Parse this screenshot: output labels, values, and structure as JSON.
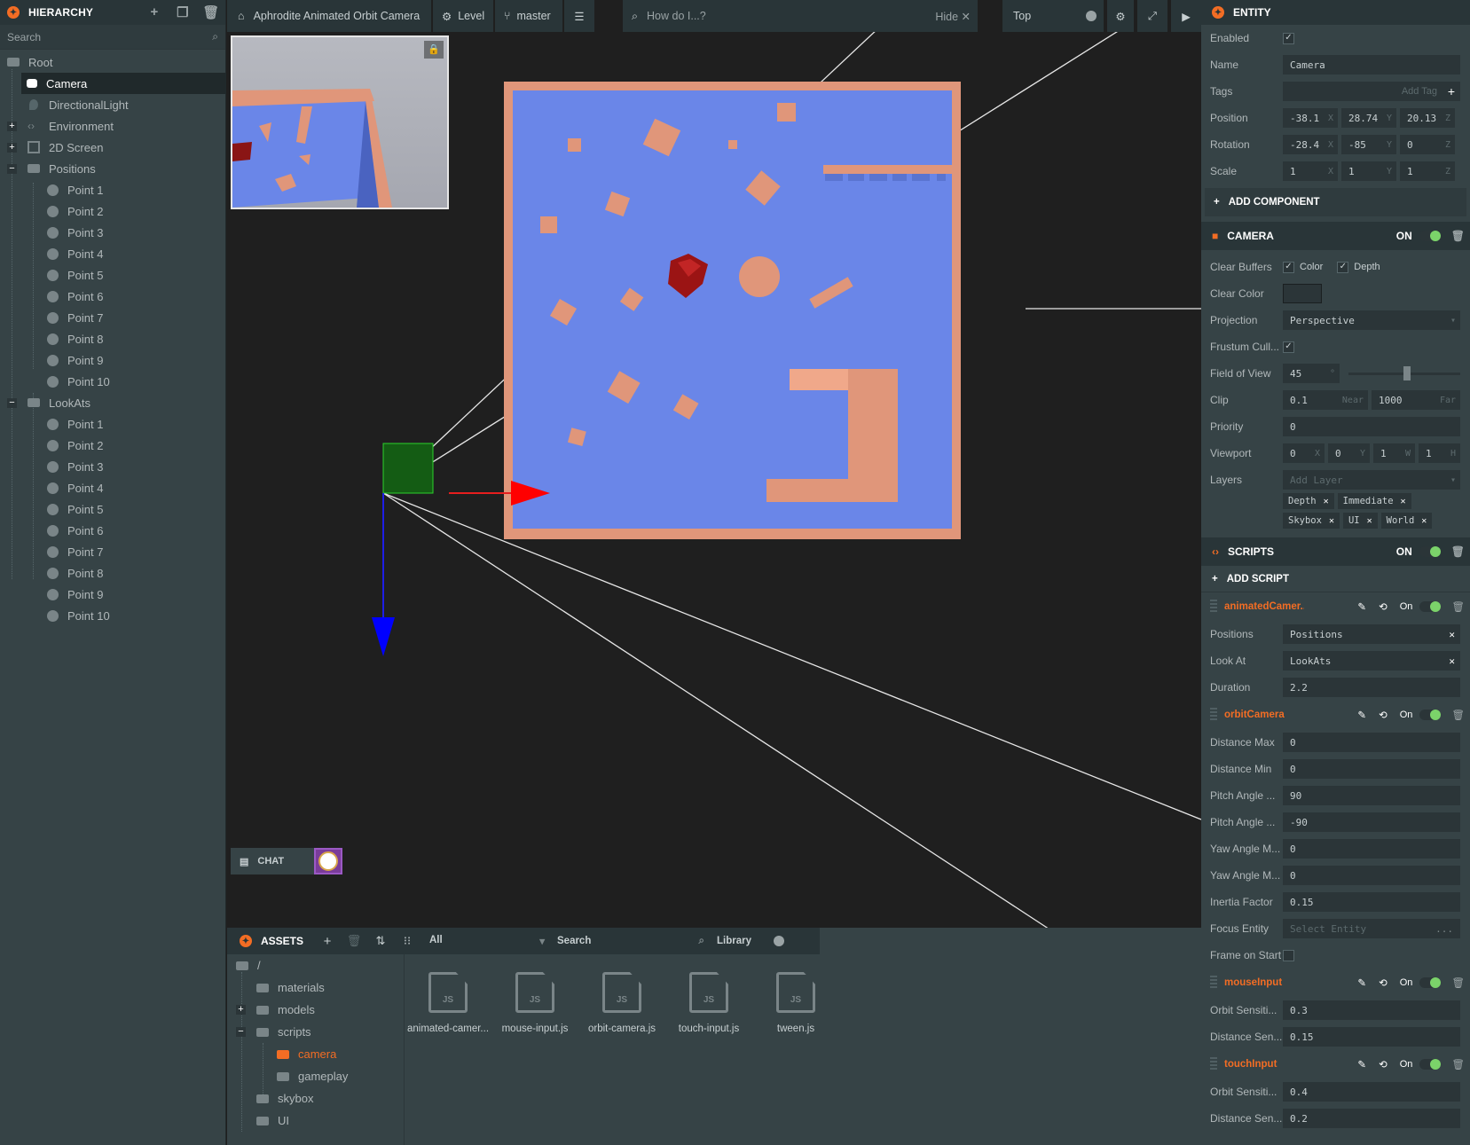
{
  "hierarchy": {
    "title": "HIERARCHY",
    "search_placeholder": "Search",
    "root": "Root",
    "camera": "Camera",
    "light": "DirectionalLight",
    "environment": "Environment",
    "screen": "2D Screen",
    "positions": "Positions",
    "lookats": "LookAts",
    "points": [
      "Point 1",
      "Point 2",
      "Point 3",
      "Point 4",
      "Point 5",
      "Point 6",
      "Point 7",
      "Point 8",
      "Point 9",
      "Point 10"
    ]
  },
  "toolbar": {
    "project": "Aphrodite Animated Orbit Camera",
    "level": "Level",
    "branch": "master",
    "help_placeholder": "How do I...?",
    "hide": "Hide",
    "view": "Top"
  },
  "chat": {
    "label": "CHAT"
  },
  "assets": {
    "title": "ASSETS",
    "filter": "All",
    "search": "Search",
    "library": "Library",
    "folders": {
      "root": "/",
      "materials": "materials",
      "models": "models",
      "scripts": "scripts",
      "camera": "camera",
      "gameplay": "gameplay",
      "skybox": "skybox",
      "ui": "UI"
    },
    "files": [
      "animated-camer...",
      "mouse-input.js",
      "orbit-camera.js",
      "touch-input.js",
      "tween.js"
    ],
    "file_badge": "JS"
  },
  "entity": {
    "title": "ENTITY",
    "enabled_label": "Enabled",
    "name_label": "Name",
    "name": "Camera",
    "tags_label": "Tags",
    "tags_placeholder": "Add Tag",
    "position_label": "Position",
    "position": [
      "-38.1",
      "28.74",
      "20.13"
    ],
    "rotation_label": "Rotation",
    "rotation": [
      "-28.4",
      "-85",
      "0"
    ],
    "scale_label": "Scale",
    "scale": [
      "1",
      "1",
      "1"
    ],
    "add_component": "ADD COMPONENT"
  },
  "camera": {
    "title": "CAMERA",
    "on": "ON",
    "clear_buffers_label": "Clear Buffers",
    "color": "Color",
    "depth": "Depth",
    "clear_color_label": "Clear Color",
    "projection_label": "Projection",
    "projection": "Perspective",
    "frustum_label": "Frustum Cull...",
    "fov_label": "Field of View",
    "fov": "45",
    "fov_unit": "°",
    "clip_label": "Clip",
    "near": "0.1",
    "near_label": "Near",
    "far": "1000",
    "far_label": "Far",
    "priority_label": "Priority",
    "priority": "0",
    "viewport_label": "Viewport",
    "viewport": [
      "0",
      "0",
      "1",
      "1"
    ],
    "layers_label": "Layers",
    "layers_placeholder": "Add Layer",
    "layers": [
      "Depth",
      "Immediate",
      "Skybox",
      "UI",
      "World"
    ]
  },
  "scripts": {
    "title": "SCRIPTS",
    "on": "ON",
    "add": "ADD SCRIPT",
    "on_small": "On",
    "animated": {
      "name": "animatedCamer...",
      "positions_label": "Positions",
      "positions": "Positions",
      "lookat_label": "Look At",
      "lookat": "LookAts",
      "duration_label": "Duration",
      "duration": "2.2"
    },
    "orbit": {
      "name": "orbitCamera",
      "fields": [
        [
          "Distance Max",
          "0"
        ],
        [
          "Distance Min",
          "0"
        ],
        [
          "Pitch Angle ...",
          "90"
        ],
        [
          "Pitch Angle ...",
          "-90"
        ],
        [
          "Yaw Angle M...",
          "0"
        ],
        [
          "Yaw Angle M...",
          "0"
        ],
        [
          "Inertia Factor",
          "0.15"
        ]
      ],
      "focus_label": "Focus Entity",
      "focus_placeholder": "Select Entity",
      "frame_label": "Frame on Start"
    },
    "mouse": {
      "name": "mouseInput",
      "orbit_label": "Orbit Sensiti...",
      "orbit": "0.3",
      "dist_label": "Distance Sen...",
      "dist": "0.15"
    },
    "touch": {
      "name": "touchInput",
      "orbit_label": "Orbit Sensiti...",
      "orbit": "0.4",
      "dist_label": "Distance Sen...",
      "dist": "0.2"
    }
  },
  "colors": {
    "accent": "#f36d24",
    "floor": "#6a86e8",
    "wall": "#e0967a",
    "panel": "#364346"
  }
}
